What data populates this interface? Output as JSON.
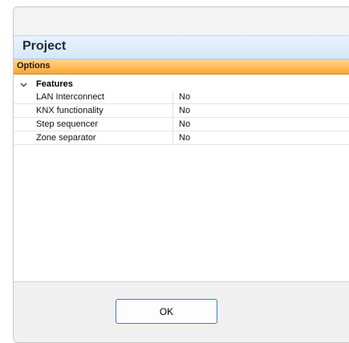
{
  "header": {
    "title": "Project"
  },
  "options": {
    "label": "Options"
  },
  "grid": {
    "category": "Features",
    "properties": [
      {
        "name": "LAN Interconnect",
        "value": "No"
      },
      {
        "name": "KNX functionality",
        "value": "No"
      },
      {
        "name": "Step sequencer",
        "value": "No"
      },
      {
        "name": "Zone separator",
        "value": "No"
      }
    ]
  },
  "footer": {
    "ok_label": "OK"
  },
  "colors": {
    "header_bg": "#d6e7fb",
    "options_bar": "#ffbf63",
    "button_border": "#3f7bd6"
  }
}
